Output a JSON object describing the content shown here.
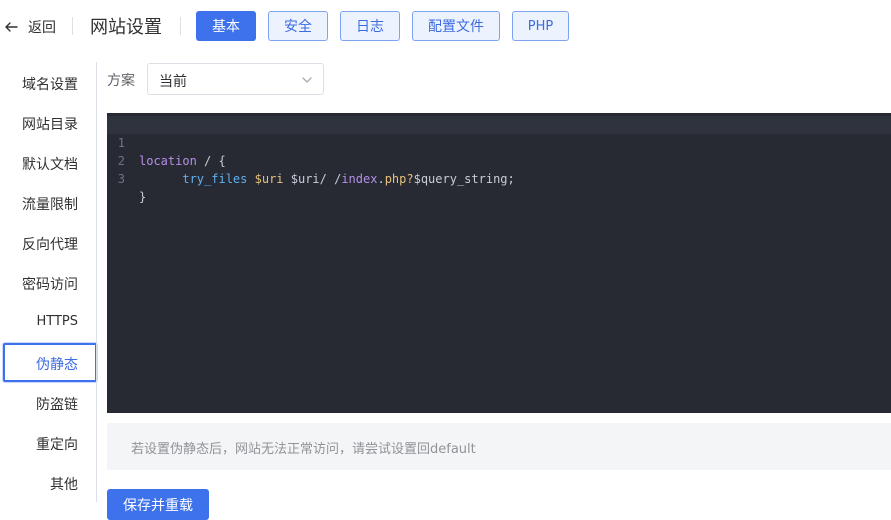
{
  "header": {
    "back_label": "返回",
    "title": "网站设置",
    "tabs": [
      {
        "label": "基本",
        "active": true
      },
      {
        "label": "安全",
        "active": false
      },
      {
        "label": "日志",
        "active": false
      },
      {
        "label": "配置文件",
        "active": false
      },
      {
        "label": "PHP",
        "active": false
      }
    ]
  },
  "sidebar": {
    "items": [
      {
        "label": "域名设置"
      },
      {
        "label": "网站目录"
      },
      {
        "label": "默认文档"
      },
      {
        "label": "流量限制"
      },
      {
        "label": "反向代理"
      },
      {
        "label": "密码访问"
      },
      {
        "label": "HTTPS"
      },
      {
        "label": "伪静态",
        "active": true
      },
      {
        "label": "防盗链"
      },
      {
        "label": "重定向"
      },
      {
        "label": "其他"
      }
    ]
  },
  "plan": {
    "label": "方案",
    "selected": "当前"
  },
  "editor": {
    "line_numbers": [
      "1",
      "2",
      "3"
    ],
    "line1": {
      "kw": "location",
      "rest": " / {"
    },
    "line2": {
      "indent": "      ",
      "fn": "try_files",
      "sp1": " ",
      "var": "$uri",
      "mid": " $uri/ /",
      "path": "index",
      "dot": ".",
      "ext": "php?",
      "tail": "$query_string;"
    },
    "line3": {
      "text": "}"
    }
  },
  "tip": "若设置伪静态后，网站无法正常访问，请尝试设置回default",
  "save_label": "保存并重载",
  "colors": {
    "accent": "#3e71ec",
    "editor_bg": "#272a33"
  }
}
